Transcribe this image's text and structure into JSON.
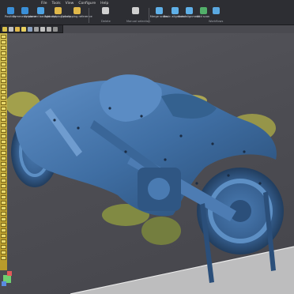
{
  "menu": [
    "File",
    "Tools",
    "View",
    "Configure",
    "Help"
  ],
  "ribbon": {
    "buttons": [
      {
        "name": "position",
        "label": "Position",
        "color": "#3a8fd8"
      },
      {
        "name": "symmetry",
        "label": "Symmetry plane",
        "color": "#3a8fd8"
      },
      {
        "name": "advanced",
        "label": "Advanced background",
        "color": "#4ea3e4"
      },
      {
        "name": "add-clipping",
        "label": "Add clipping plane",
        "color": "#e0b84a"
      },
      {
        "name": "set-clipping",
        "label": "Set clipping reference",
        "color": "#e0b84a"
      },
      {
        "name": "delete",
        "label": "Delete",
        "color": "#d0d0d0"
      },
      {
        "name": "manual",
        "label": "Manual selection",
        "color": "#d0d0d0"
      },
      {
        "name": "merge",
        "label": "Merge scans",
        "color": "#5fb0e8"
      },
      {
        "name": "basic-align",
        "label": "Basic alignment",
        "color": "#5fb0e8"
      },
      {
        "name": "auto-align",
        "label": "Auto alignment",
        "color": "#5fb0e8"
      },
      {
        "name": "add",
        "label": "Add scan",
        "color": "#52b06a"
      },
      {
        "name": "workflows",
        "label": "Workflows",
        "color": "#5aa8e0"
      }
    ],
    "group_labels": [
      "Delete",
      "Manual selection",
      "Workflows"
    ]
  },
  "colors": {
    "model": "#3f6ea3",
    "model_dark": "#2b4f7a",
    "highlight": "#6f9ccf",
    "vegetation": "#b7b44a",
    "floor": "#cfcfcf"
  }
}
